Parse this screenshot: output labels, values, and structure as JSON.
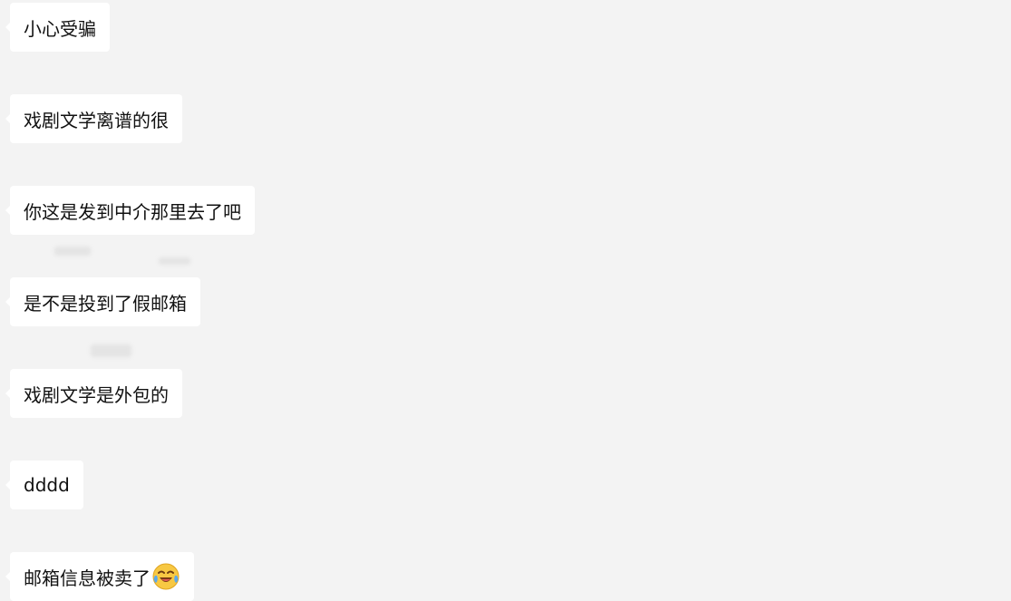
{
  "messages": [
    {
      "text": "小心受骗"
    },
    {
      "text": "戏剧文学离谱的很"
    },
    {
      "text": "你这是发到中介那里去了吧"
    },
    {
      "text": "是不是投到了假邮箱"
    },
    {
      "text": "戏剧文学是外包的"
    },
    {
      "text": "dddd"
    },
    {
      "text": "邮箱信息被卖了",
      "emoji": "laughing-crying-emoji"
    }
  ],
  "colors": {
    "background": "#f3f3f3",
    "bubble": "#ffffff",
    "text": "#111111"
  }
}
